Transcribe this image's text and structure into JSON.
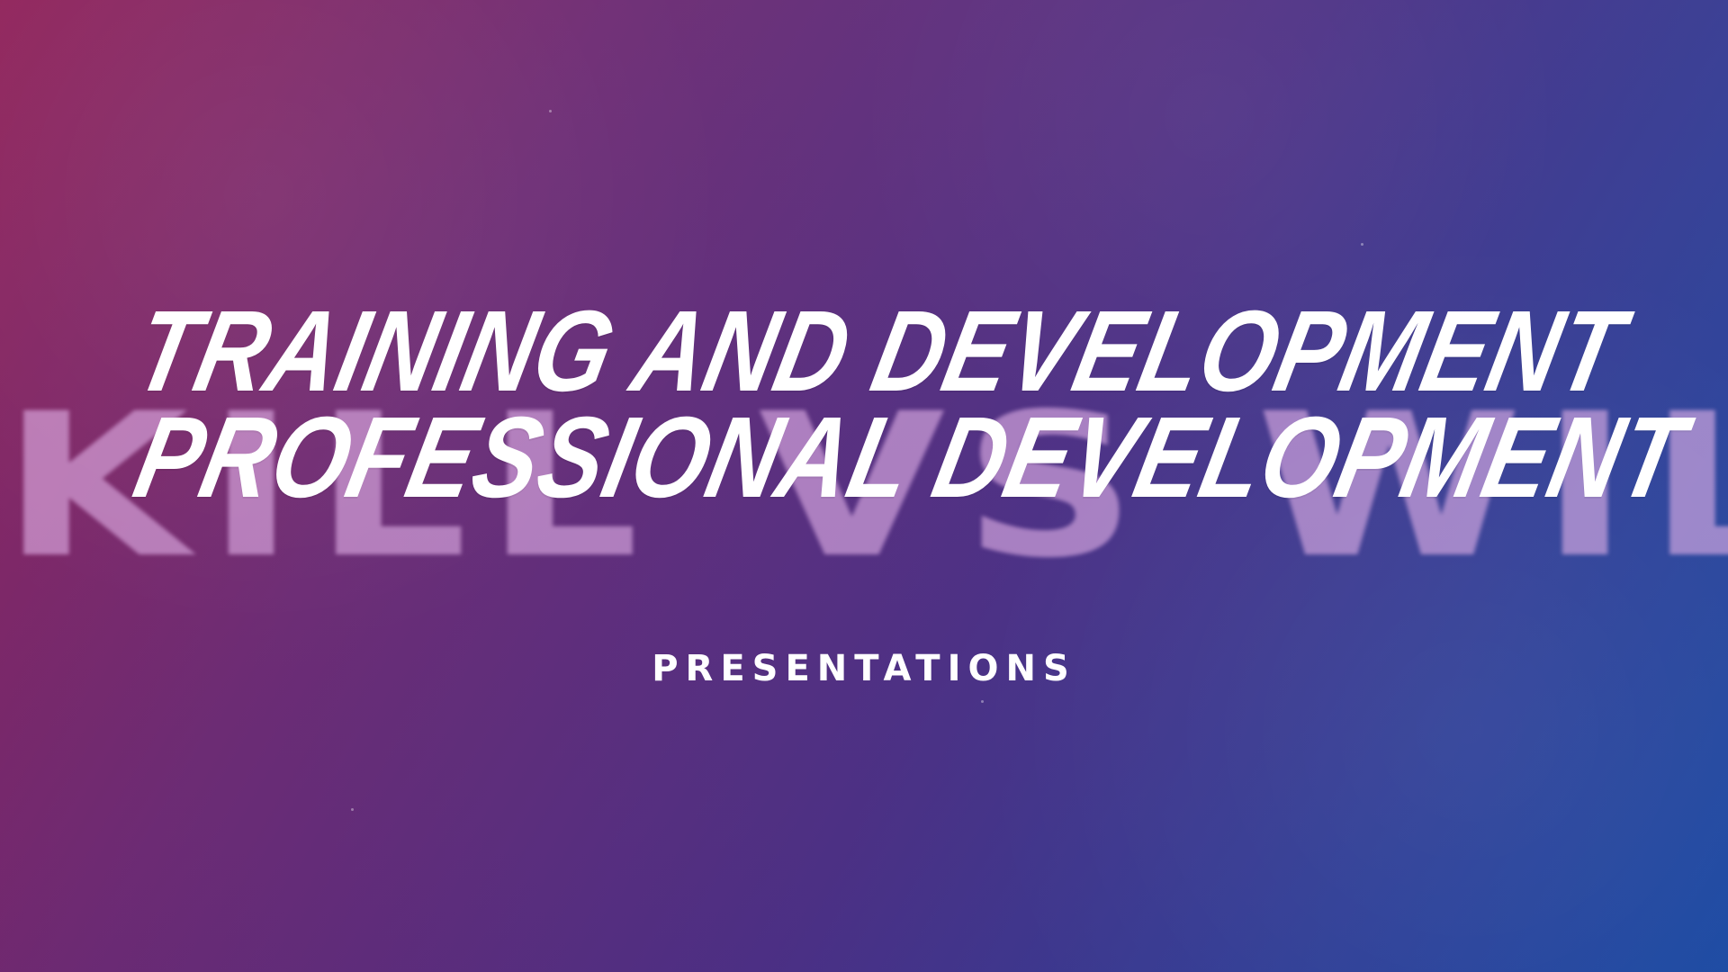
{
  "slide": {
    "background_word": "SKILL VS WILL",
    "title_line_1": "TRAINING AND DEVELOPMENT",
    "title_line_2": "PROFESSIONAL DEVELOPMENT",
    "subtitle": "PRESENTATIONS"
  },
  "colors": {
    "text_primary": "#ffffff",
    "background_start": "#8e1f57",
    "background_mid": "#4b2f84",
    "background_end": "#1b4aa3",
    "background_word": "#e0b0e6"
  }
}
